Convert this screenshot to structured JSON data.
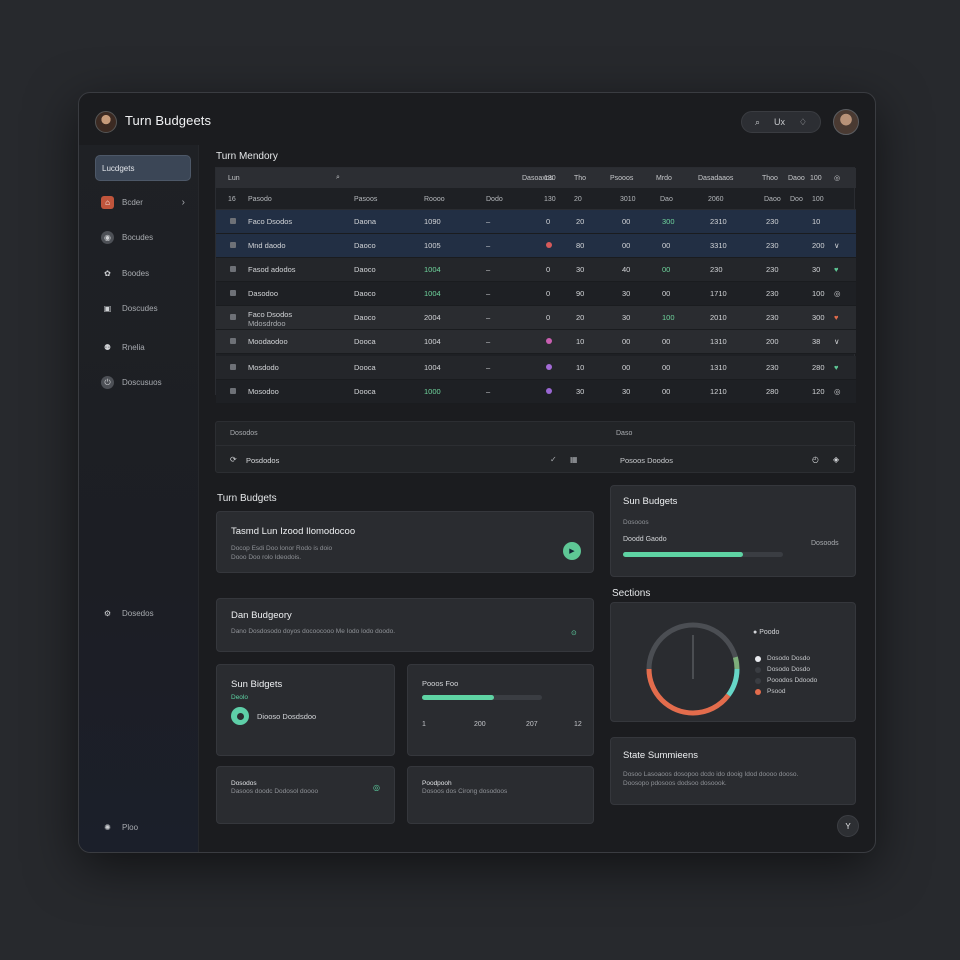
{
  "app": {
    "title": "Turn Budgeets"
  },
  "header": {
    "search_icon": "search-icon",
    "search_label": "Ux",
    "bell_icon": "bell-icon"
  },
  "sidebar": {
    "items": [
      {
        "label": "Lucdgets",
        "icon": "list-icon"
      },
      {
        "label": "Bcder",
        "icon": "home-icon"
      },
      {
        "label": "Bocudes",
        "icon": "globe-icon"
      },
      {
        "label": "Boodes",
        "icon": "paw-icon"
      },
      {
        "label": "Doscudes",
        "icon": "box-icon"
      },
      {
        "label": "Rnelia",
        "icon": "users-icon"
      },
      {
        "label": "Doscusuos",
        "icon": "power-icon"
      }
    ],
    "bottom_item": {
      "label": "Dosedos",
      "icon": "settings-icon"
    },
    "footer_item": {
      "label": "Ploo",
      "icon": "gear-icon"
    }
  },
  "table": {
    "title": "Turn Mendory",
    "toolbar": {
      "left": "Lun",
      "right_cols": [
        "Dasoaxos",
        "130",
        "Tho",
        "Psooos",
        "Mrdo",
        "Dasadaaos",
        "Thoo",
        "Daoo",
        "100"
      ]
    },
    "head": [
      "16",
      "Pasodo",
      "Pasoos",
      "Roooo",
      "Dodo",
      "130",
      "20",
      "3010",
      "Dao",
      "2060",
      "Daoo",
      "Doo",
      "100"
    ],
    "rows": [
      {
        "name": "Faco Dsodos",
        "cat": "Daona",
        "amt": "1090",
        "dash": "–",
        "state": "0",
        "a": "20",
        "b": "00",
        "c": "300",
        "d": "2310",
        "e": "230",
        "f": "10",
        "last": "",
        "style": "dark",
        "dot_color": "",
        "amt_green": false,
        "c_green": true
      },
      {
        "name": "Mnd daodo",
        "cat": "Daoco",
        "amt": "1005",
        "dash": "–",
        "state": "",
        "a": "80",
        "b": "00",
        "c": "00",
        "d": "3310",
        "e": "230",
        "f": "200",
        "last": "∨",
        "style": "dark",
        "dot_color": "#d65a5a",
        "amt_green": false,
        "c_green": false
      },
      {
        "name": "Fasod adodos",
        "cat": "Daoco",
        "amt": "1004",
        "dash": "–",
        "state": "0",
        "a": "30",
        "b": "40",
        "c": "00",
        "d": "230",
        "e": "230",
        "f": "30",
        "last": "♥",
        "style": "mid",
        "dot_color": "",
        "amt_green": true,
        "c_green": true
      },
      {
        "name": "Dasodoo",
        "cat": "Daoco",
        "amt": "1004",
        "dash": "–",
        "state": "0",
        "a": "90",
        "b": "30",
        "c": "00",
        "d": "1710",
        "e": "230",
        "f": "100",
        "last": "◎",
        "style": "dark2",
        "dot_color": "",
        "amt_green": true,
        "c_green": false
      },
      {
        "name": "Faco Dsodos",
        "name2": "Mdosdrdoo",
        "cat": "Daoco",
        "amt": "2004",
        "dash": "–",
        "state": "0",
        "a": "20",
        "b": "30",
        "c": "100",
        "d": "2010",
        "e": "230",
        "f": "300",
        "last": "♥",
        "style": "alt",
        "dot_color": "",
        "amt_green": false,
        "c_green": true
      },
      {
        "name": "Moodaodoo",
        "cat": "Dooca",
        "amt": "1004",
        "dash": "–",
        "state": "",
        "a": "10",
        "b": "00",
        "c": "00",
        "d": "1310",
        "e": "200",
        "f": "38",
        "last": "∨",
        "style": "alt",
        "dot_color": "#c95fb1",
        "amt_green": false,
        "c_green": false
      },
      {
        "name": "Mosdodo",
        "cat": "Dooca",
        "amt": "1004",
        "dash": "–",
        "state": "",
        "a": "10",
        "b": "00",
        "c": "00",
        "d": "1310",
        "e": "230",
        "f": "280",
        "last": "♥",
        "style": "mid",
        "dot_color": "#a36bd6",
        "amt_green": false,
        "c_green": false
      },
      {
        "name": "Mosodoo",
        "cat": "Dooca",
        "amt": "1000",
        "dash": "–",
        "state": "",
        "a": "30",
        "b": "30",
        "c": "00",
        "d": "1210",
        "e": "280",
        "f": "120",
        "last": "◎",
        "style": "dark2",
        "dot_color": "#9a67d3",
        "amt_green": true,
        "c_green": false
      }
    ]
  },
  "info": {
    "head_left": "Dosodos",
    "head_right": "Daso",
    "row_left": "Posdodos",
    "row_right": "Posoos Doodos"
  },
  "budgets": {
    "title": "Turn Budgets",
    "card1": {
      "title": "Tasmd Lun Izood Ilomodocoo",
      "sub1": "Docop Esdi Doo lonor Rodo is doio",
      "sub2": "Dooo Doo rolo Ideodois.",
      "btn": "▶"
    },
    "card2": {
      "title": "Dan Budgeory",
      "sub": "Dano Dosdosodo doyos docoocooo Me Iodo lodo doodo.",
      "btn": "⊙"
    },
    "card3": {
      "title": "Sun Bidgets",
      "sub": "Deolo",
      "item": "Diooso Dosdsdoo"
    },
    "card4": {
      "label": "Pooos Foo",
      "ticks": [
        "1",
        "200",
        "207",
        "12"
      ],
      "progress": 0.6
    },
    "card5": {
      "title": "Dosodos",
      "sub": "Dasoos doodc Dodosol doooo"
    },
    "card6": {
      "title": "Poodpooh",
      "sub": "Dosoos dos Cirong dosodoos"
    }
  },
  "right": {
    "stats": {
      "title": "Sun Budgets",
      "sub": "Dosooos",
      "label": "Doodd Gaodo",
      "right_label": "Dosoods",
      "progress": 0.75
    },
    "sections_title": "Sections",
    "donut": {
      "center_label": "Poodo",
      "legend": [
        "Dosodo Dosdo",
        "Dosodo Dosdo",
        "Pooodos Ddoodo",
        "Psood"
      ]
    },
    "summary": {
      "title": "State Summieens",
      "sub1": "Dosoo Lasoaoos dosopoo dcdo ido dooig Idod doooo dooso.",
      "sub2": "Doosopo pdosoos dodsoo dosoook."
    }
  },
  "help": {
    "label": "Y"
  },
  "colors": {
    "accent": "#5ed3a3",
    "brand": "#3b4656",
    "danger": "#e36c4c"
  }
}
